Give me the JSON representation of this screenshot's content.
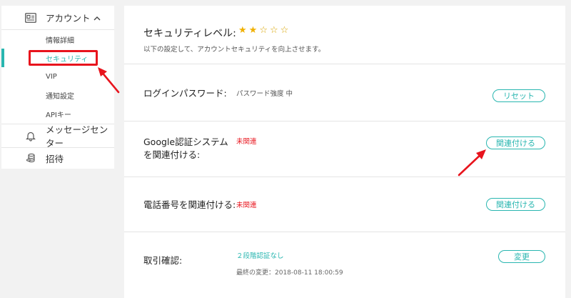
{
  "sidebar": {
    "account": {
      "label": "アカウント",
      "icon": "id-card-icon",
      "chevron": "chevron-up-icon"
    },
    "items": [
      {
        "label": "情報詳細"
      },
      {
        "label": "セキュリティ"
      },
      {
        "label": "VIP"
      },
      {
        "label": "通知設定"
      },
      {
        "label": "APIキー"
      }
    ],
    "messages": {
      "label": "メッセージセンター",
      "icon": "bell-icon"
    },
    "invite": {
      "label": "招待",
      "icon": "coins-icon"
    }
  },
  "security": {
    "title": "セキュリティレベル:",
    "stars_filled": 2,
    "stars_total": 5,
    "subtitle": "以下の設定して、アカウントセキュリティを向上させます。"
  },
  "login_password": {
    "label": "ログインパスワード:",
    "value": "パスワード強度 中",
    "button": "リセット"
  },
  "google_auth": {
    "label_line1": "Google認証システム",
    "label_line2": "を関連付ける:",
    "status": "未関連",
    "button": "関連付ける"
  },
  "phone": {
    "label": "電話番号を関連付ける:",
    "status": "未関連",
    "button": "関連付ける"
  },
  "trade_confirm": {
    "label": "取引確認:",
    "value": "２段階認証なし",
    "last_changed": "最終の変更：2018-08-11 18:00:59",
    "button": "変更"
  },
  "colors": {
    "accent": "#29b6b0",
    "highlight": "#e8141d",
    "star": "#f0b000"
  }
}
